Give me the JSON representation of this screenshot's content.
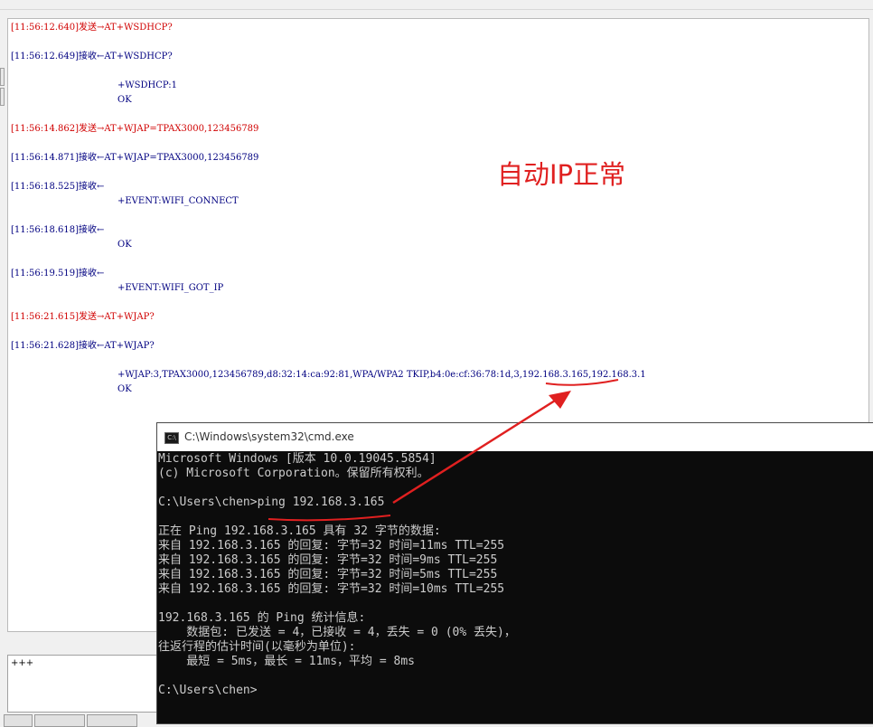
{
  "log": {
    "lines": [
      {
        "t": "[11:56:12.640]发送→AT+WSDHCP?",
        "kind": "send"
      },
      {
        "t": "[11:56:12.649]接收←AT+WSDHCP?",
        "kind": "recv"
      },
      {
        "t": "+WSDHCP:1",
        "kind": "ind"
      },
      {
        "t": "OK",
        "kind": "ind"
      },
      {
        "t": "[11:56:14.862]发送→AT+WJAP=TPAX3000,123456789",
        "kind": "send"
      },
      {
        "t": "[11:56:14.871]接收←AT+WJAP=TPAX3000,123456789",
        "kind": "recv"
      },
      {
        "t": "[11:56:18.525]接收←",
        "kind": "recv"
      },
      {
        "t": "+EVENT:WIFI_CONNECT",
        "kind": "ind"
      },
      {
        "t": "[11:56:18.618]接收←",
        "kind": "recv"
      },
      {
        "t": "OK",
        "kind": "ind"
      },
      {
        "t": "[11:56:19.519]接收←",
        "kind": "recv"
      },
      {
        "t": "+EVENT:WIFI_GOT_IP",
        "kind": "ind"
      },
      {
        "t": "[11:56:21.615]发送→AT+WJAP?",
        "kind": "send"
      },
      {
        "t": "[11:56:21.628]接收←AT+WJAP?",
        "kind": "recv"
      },
      {
        "t": "+WJAP:3,TPAX3000,123456789,d8:32:14:ca:92:81,WPA/WPA2 TKIP,b4:0e:cf:36:78:1d,3,192.168.3.165,192.168.3.1",
        "kind": "ind"
      },
      {
        "t": "OK",
        "kind": "ind"
      }
    ],
    "annotation": "自动IP正常"
  },
  "send_area": {
    "text": "+++"
  },
  "cmd": {
    "title": "C:\\Windows\\system32\\cmd.exe",
    "icon_text": "C:\\",
    "lines": [
      "Microsoft Windows [版本 10.0.19045.5854]",
      "(c) Microsoft Corporation。保留所有权利。",
      "",
      "C:\\Users\\chen>ping 192.168.3.165",
      "",
      "正在 Ping 192.168.3.165 具有 32 字节的数据:",
      "来自 192.168.3.165 的回复: 字节=32 时间=11ms TTL=255",
      "来自 192.168.3.165 的回复: 字节=32 时间=9ms TTL=255",
      "来自 192.168.3.165 的回复: 字节=32 时间=5ms TTL=255",
      "来自 192.168.3.165 的回复: 字节=32 时间=10ms TTL=255",
      "",
      "192.168.3.165 的 Ping 统计信息:",
      "    数据包: 已发送 = 4，已接收 = 4，丢失 = 0 (0% 丢失)，",
      "往返行程的估计时间(以毫秒为单位):",
      "    最短 = 5ms，最长 = 11ms，平均 = 8ms",
      "",
      "C:\\Users\\chen>"
    ]
  },
  "colors": {
    "send": "#d00000",
    "recv": "#000080",
    "annotation": "#e02020",
    "cmd_bg": "#0c0c0c",
    "cmd_fg": "#cccccc"
  }
}
